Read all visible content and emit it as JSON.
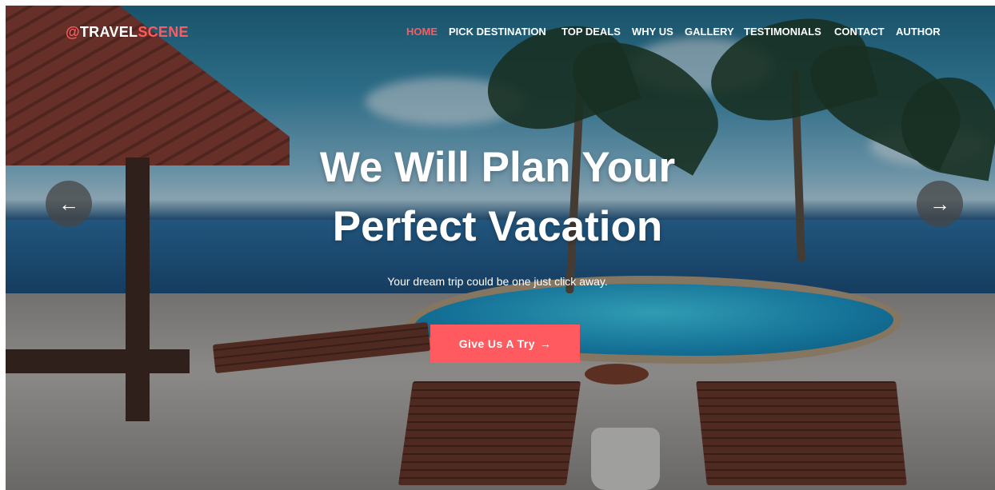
{
  "brand": {
    "icon": "logo-at-icon",
    "part1": "TRAVEL",
    "part2": "SCENE",
    "accent": "#ff5a5f"
  },
  "nav": {
    "items": [
      {
        "label": "HOME",
        "active": true
      },
      {
        "label": "PICK DESTINATION"
      },
      {
        "label": "TOP DEALS"
      },
      {
        "label": "WHY US"
      },
      {
        "label": "GALLERY"
      },
      {
        "label": "TESTIMONIALS"
      },
      {
        "label": "CONTACT"
      },
      {
        "label": "AUTHOR"
      }
    ]
  },
  "hero": {
    "title_line1": "We Will Plan Your",
    "title_line2": "Perfect Vacation",
    "subtitle": "Your dream trip could be one just click away.",
    "cta_label": "Give Us A Try",
    "cta_icon": "arrow-right-icon",
    "prev_icon": "arrow-left-icon",
    "next_icon": "arrow-right-icon"
  }
}
